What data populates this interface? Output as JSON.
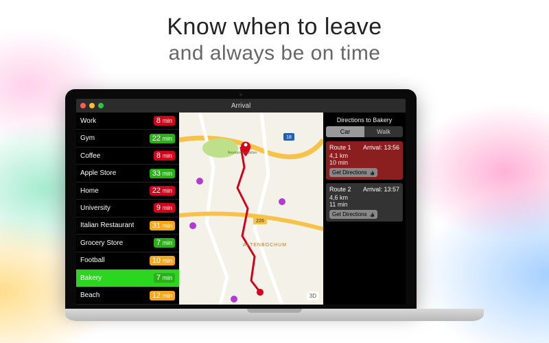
{
  "headline": {
    "line1": "Know when to leave",
    "line2": "and always be on time"
  },
  "window": {
    "title": "Arrival"
  },
  "sidebar": {
    "items": [
      {
        "name": "Work",
        "time": "8",
        "unit": "min",
        "color": "red",
        "selected": false
      },
      {
        "name": "Gym",
        "time": "22",
        "unit": "min",
        "color": "green",
        "selected": false
      },
      {
        "name": "Coffee",
        "time": "8",
        "unit": "min",
        "color": "red",
        "selected": false
      },
      {
        "name": "Apple Store",
        "time": "33",
        "unit": "min",
        "color": "green",
        "selected": false
      },
      {
        "name": "Home",
        "time": "22",
        "unit": "min",
        "color": "red",
        "selected": false
      },
      {
        "name": "University",
        "time": "9",
        "unit": "min",
        "color": "red",
        "selected": false
      },
      {
        "name": "Italian Restaurant",
        "time": "31",
        "unit": "min",
        "color": "orange",
        "selected": false
      },
      {
        "name": "Grocery Store",
        "time": "7",
        "unit": "min",
        "color": "green",
        "selected": false
      },
      {
        "name": "Football",
        "time": "10",
        "unit": "min",
        "color": "orange",
        "selected": false
      },
      {
        "name": "Bakery",
        "time": "7",
        "unit": "min",
        "color": "green",
        "selected": true
      },
      {
        "name": "Beach",
        "time": "12",
        "unit": "min",
        "color": "orange",
        "selected": false
      }
    ]
  },
  "panel": {
    "title": "Directions to Bakery",
    "modes": {
      "car": "Car",
      "walk": "Walk",
      "active": "car"
    },
    "routes": [
      {
        "header": "Route 1",
        "arrival_label": "Arrival:",
        "arrival": "13:56",
        "distance": "4,1 km",
        "duration": "10 min",
        "button": "Get Directions"
      },
      {
        "header": "Route 2",
        "arrival_label": "Arrival:",
        "arrival": "13:57",
        "distance": "4,6 km",
        "duration": "11 min",
        "button": "Get Directions"
      }
    ]
  },
  "map": {
    "control3d": "3D",
    "district": "ALTENBOCHUM",
    "road_labels": [
      "18",
      "226"
    ],
    "stadium_label": "Rewirpower­stadion"
  }
}
